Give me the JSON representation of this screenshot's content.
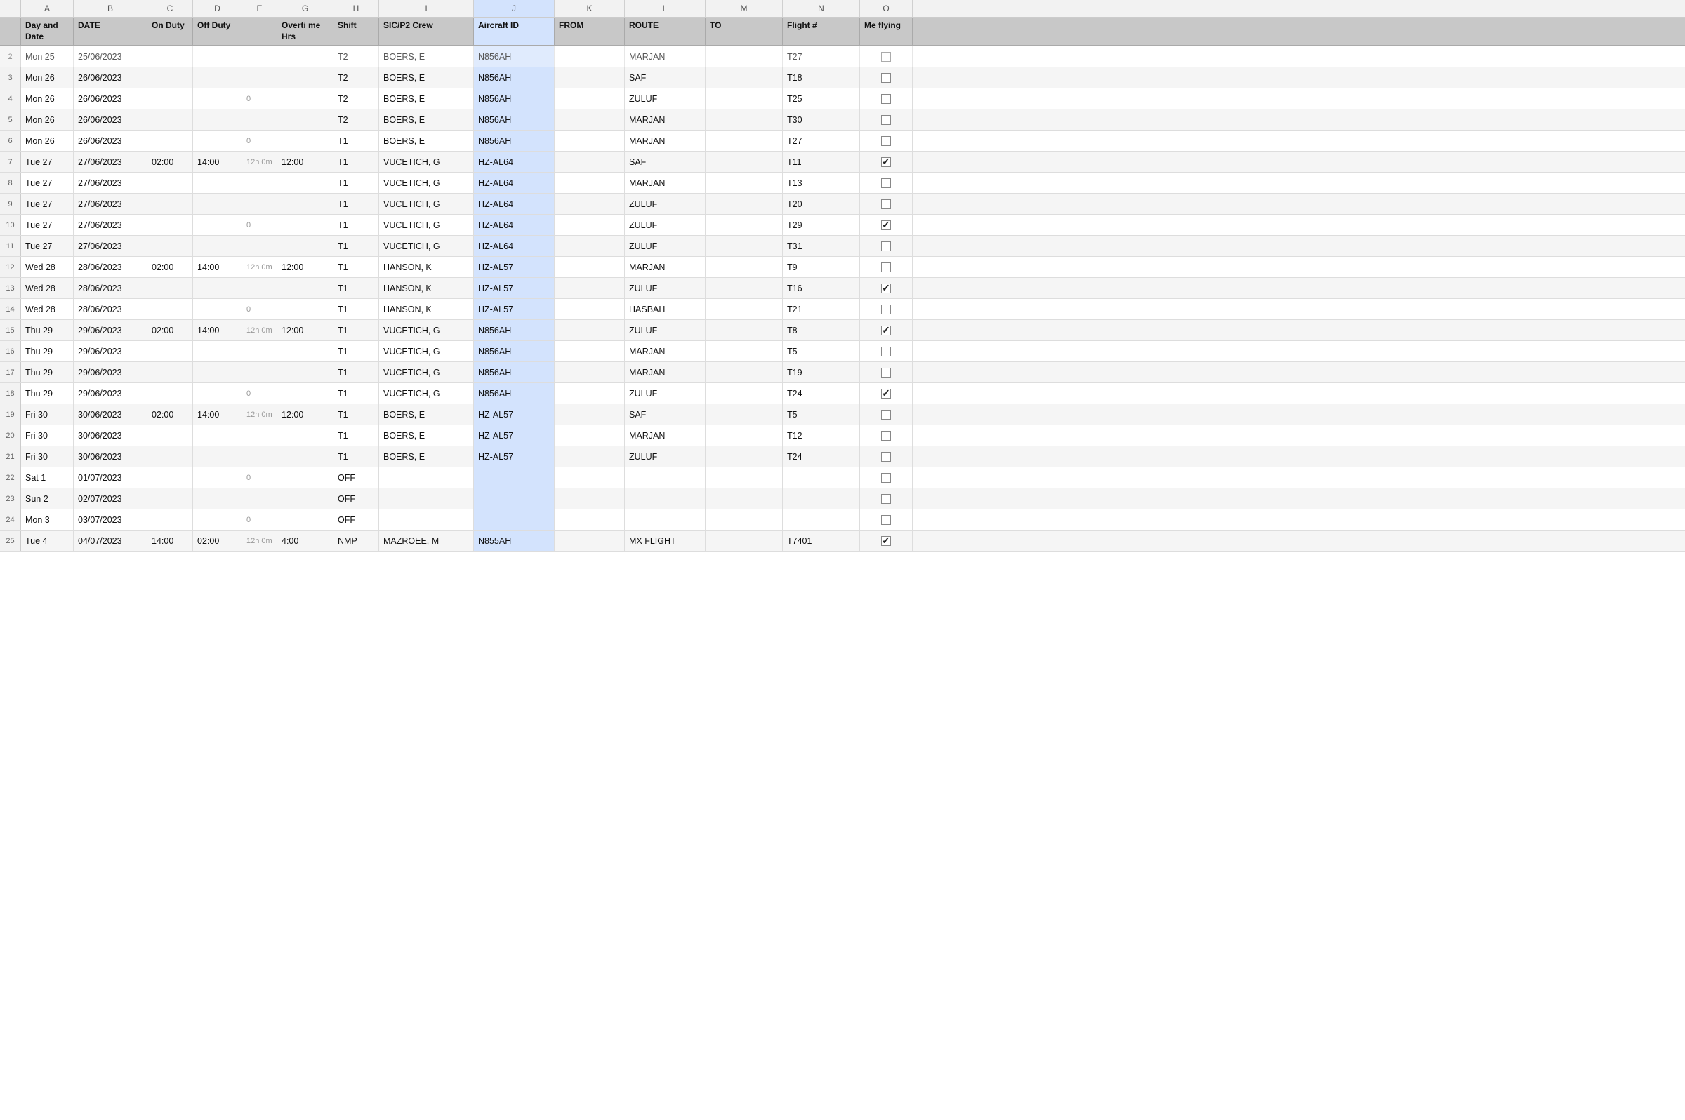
{
  "columns": {
    "letters": [
      "A",
      "B",
      "C",
      "D",
      "E",
      "G",
      "H",
      "I",
      "J",
      "K",
      "L",
      "M",
      "N",
      "O"
    ],
    "headers": [
      "Day and Date",
      "DATE",
      "On Duty",
      "Off Duty",
      "",
      "Overti me Hrs",
      "Shift",
      "SIC/P2 Crew",
      "Aircraft ID",
      "FROM",
      "ROUTE",
      "TO",
      "Flight #",
      "Me flying"
    ]
  },
  "rows": [
    {
      "day": "Mon 25",
      "date": "25/06/2023",
      "on_duty": "",
      "off_duty": "",
      "col_e": "",
      "overtime": "",
      "shift": "T2",
      "crew": "BOERS, E",
      "aircraft": "N856AH",
      "from": "",
      "route": "MARJAN",
      "to": "",
      "flight": "T27",
      "me_flying": false,
      "partial": true
    },
    {
      "day": "Mon 26",
      "date": "26/06/2023",
      "on_duty": "",
      "off_duty": "",
      "col_e": "",
      "overtime": "",
      "shift": "T2",
      "crew": "BOERS, E",
      "aircraft": "N856AH",
      "from": "",
      "route": "SAF",
      "to": "",
      "flight": "T18",
      "me_flying": false
    },
    {
      "day": "Mon 26",
      "date": "26/06/2023",
      "on_duty": "",
      "off_duty": "",
      "col_e": "0",
      "overtime": "",
      "shift": "T2",
      "crew": "BOERS, E",
      "aircraft": "N856AH",
      "from": "",
      "route": "ZULUF",
      "to": "",
      "flight": "T25",
      "me_flying": false
    },
    {
      "day": "Mon 26",
      "date": "26/06/2023",
      "on_duty": "",
      "off_duty": "",
      "col_e": "",
      "overtime": "",
      "shift": "T2",
      "crew": "BOERS, E",
      "aircraft": "N856AH",
      "from": "",
      "route": "MARJAN",
      "to": "",
      "flight": "T30",
      "me_flying": false
    },
    {
      "day": "Mon 26",
      "date": "26/06/2023",
      "on_duty": "",
      "off_duty": "",
      "col_e": "0",
      "overtime": "",
      "shift": "T1",
      "crew": "BOERS, E",
      "aircraft": "N856AH",
      "from": "",
      "route": "MARJAN",
      "to": "",
      "flight": "T27",
      "me_flying": false
    },
    {
      "day": "Tue 27",
      "date": "27/06/2023",
      "on_duty": "02:00",
      "off_duty": "14:00",
      "col_e": "12h 0m",
      "overtime": "12:00",
      "shift": "T1",
      "crew": "VUCETICH, G",
      "aircraft": "HZ-AL64",
      "from": "",
      "route": "SAF",
      "to": "",
      "flight": "T11",
      "me_flying": true
    },
    {
      "day": "Tue 27",
      "date": "27/06/2023",
      "on_duty": "",
      "off_duty": "",
      "col_e": "",
      "overtime": "",
      "shift": "T1",
      "crew": "VUCETICH, G",
      "aircraft": "HZ-AL64",
      "from": "",
      "route": "MARJAN",
      "to": "",
      "flight": "T13",
      "me_flying": false
    },
    {
      "day": "Tue 27",
      "date": "27/06/2023",
      "on_duty": "",
      "off_duty": "",
      "col_e": "",
      "overtime": "",
      "shift": "T1",
      "crew": "VUCETICH, G",
      "aircraft": "HZ-AL64",
      "from": "",
      "route": "ZULUF",
      "to": "",
      "flight": "T20",
      "me_flying": false
    },
    {
      "day": "Tue 27",
      "date": "27/06/2023",
      "on_duty": "",
      "off_duty": "",
      "col_e": "0",
      "overtime": "",
      "shift": "T1",
      "crew": "VUCETICH, G",
      "aircraft": "HZ-AL64",
      "from": "",
      "route": "ZULUF",
      "to": "",
      "flight": "T29",
      "me_flying": true
    },
    {
      "day": "Tue 27",
      "date": "27/06/2023",
      "on_duty": "",
      "off_duty": "",
      "col_e": "",
      "overtime": "",
      "shift": "T1",
      "crew": "VUCETICH, G",
      "aircraft": "HZ-AL64",
      "from": "",
      "route": "ZULUF",
      "to": "",
      "flight": "T31",
      "me_flying": false
    },
    {
      "day": "Wed 28",
      "date": "28/06/2023",
      "on_duty": "02:00",
      "off_duty": "14:00",
      "col_e": "12h 0m",
      "overtime": "12:00",
      "shift": "T1",
      "crew": "HANSON, K",
      "aircraft": "HZ-AL57",
      "from": "",
      "route": "MARJAN",
      "to": "",
      "flight": "T9",
      "me_flying": false
    },
    {
      "day": "Wed 28",
      "date": "28/06/2023",
      "on_duty": "",
      "off_duty": "",
      "col_e": "",
      "overtime": "",
      "shift": "T1",
      "crew": "HANSON, K",
      "aircraft": "HZ-AL57",
      "from": "",
      "route": "ZULUF",
      "to": "",
      "flight": "T16",
      "me_flying": true
    },
    {
      "day": "Wed 28",
      "date": "28/06/2023",
      "on_duty": "",
      "off_duty": "",
      "col_e": "0",
      "overtime": "",
      "shift": "T1",
      "crew": "HANSON, K",
      "aircraft": "HZ-AL57",
      "from": "",
      "route": "HASBAH",
      "to": "",
      "flight": "T21",
      "me_flying": false
    },
    {
      "day": "Thu 29",
      "date": "29/06/2023",
      "on_duty": "02:00",
      "off_duty": "14:00",
      "col_e": "12h 0m",
      "overtime": "12:00",
      "shift": "T1",
      "crew": "VUCETICH, G",
      "aircraft": "N856AH",
      "from": "",
      "route": "ZULUF",
      "to": "",
      "flight": "T8",
      "me_flying": true
    },
    {
      "day": "Thu 29",
      "date": "29/06/2023",
      "on_duty": "",
      "off_duty": "",
      "col_e": "",
      "overtime": "",
      "shift": "T1",
      "crew": "VUCETICH, G",
      "aircraft": "N856AH",
      "from": "",
      "route": "MARJAN",
      "to": "",
      "flight": "T5",
      "me_flying": false
    },
    {
      "day": "Thu 29",
      "date": "29/06/2023",
      "on_duty": "",
      "off_duty": "",
      "col_e": "",
      "overtime": "",
      "shift": "T1",
      "crew": "VUCETICH, G",
      "aircraft": "N856AH",
      "from": "",
      "route": "MARJAN",
      "to": "",
      "flight": "T19",
      "me_flying": false
    },
    {
      "day": "Thu 29",
      "date": "29/06/2023",
      "on_duty": "",
      "off_duty": "",
      "col_e": "0",
      "overtime": "",
      "shift": "T1",
      "crew": "VUCETICH, G",
      "aircraft": "N856AH",
      "from": "",
      "route": "ZULUF",
      "to": "",
      "flight": "T24",
      "me_flying": true
    },
    {
      "day": "Fri 30",
      "date": "30/06/2023",
      "on_duty": "02:00",
      "off_duty": "14:00",
      "col_e": "12h 0m",
      "overtime": "12:00",
      "shift": "T1",
      "crew": "BOERS, E",
      "aircraft": "HZ-AL57",
      "from": "",
      "route": "SAF",
      "to": "",
      "flight": "T5",
      "me_flying": false
    },
    {
      "day": "Fri 30",
      "date": "30/06/2023",
      "on_duty": "",
      "off_duty": "",
      "col_e": "",
      "overtime": "",
      "shift": "T1",
      "crew": "BOERS, E",
      "aircraft": "HZ-AL57",
      "from": "",
      "route": "MARJAN",
      "to": "",
      "flight": "T12",
      "me_flying": false
    },
    {
      "day": "Fri 30",
      "date": "30/06/2023",
      "on_duty": "",
      "off_duty": "",
      "col_e": "",
      "overtime": "",
      "shift": "T1",
      "crew": "BOERS, E",
      "aircraft": "HZ-AL57",
      "from": "",
      "route": "ZULUF",
      "to": "",
      "flight": "T24",
      "me_flying": false
    },
    {
      "day": "Sat 1",
      "date": "01/07/2023",
      "on_duty": "",
      "off_duty": "",
      "col_e": "0",
      "overtime": "",
      "shift": "OFF",
      "crew": "",
      "aircraft": "",
      "from": "",
      "route": "",
      "to": "",
      "flight": "",
      "me_flying": false
    },
    {
      "day": "Sun 2",
      "date": "02/07/2023",
      "on_duty": "",
      "off_duty": "",
      "col_e": "",
      "overtime": "",
      "shift": "OFF",
      "crew": "",
      "aircraft": "",
      "from": "",
      "route": "",
      "to": "",
      "flight": "",
      "me_flying": false
    },
    {
      "day": "Mon 3",
      "date": "03/07/2023",
      "on_duty": "",
      "off_duty": "",
      "col_e": "0",
      "overtime": "",
      "shift": "OFF",
      "crew": "",
      "aircraft": "",
      "from": "",
      "route": "",
      "to": "",
      "flight": "",
      "me_flying": false
    },
    {
      "day": "Tue 4",
      "date": "04/07/2023",
      "on_duty": "14:00",
      "off_duty": "02:00",
      "col_e": "12h 0m",
      "overtime": "4:00",
      "shift": "NMP",
      "crew": "MAZROEE, M",
      "aircraft": "N855AH",
      "from": "",
      "route": "MX FLIGHT",
      "to": "",
      "flight": "T7401",
      "me_flying": true
    }
  ]
}
